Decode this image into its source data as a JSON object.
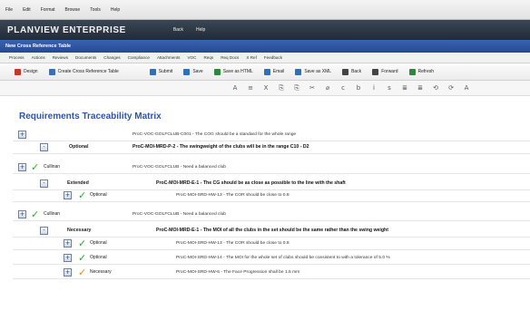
{
  "menubar": {
    "items": [
      "File",
      "Edit",
      "Format",
      "Browse",
      "Tools",
      "Help"
    ]
  },
  "brandbar": {
    "brand": "PLANVIEW ENTERPRISE",
    "nav": [
      "Back",
      "Help"
    ]
  },
  "titlebar": {
    "title": "New Cross Reference Table"
  },
  "tabs": [
    "Process",
    "Actions",
    "Reviews",
    "Documents",
    "Changes",
    "Compliance",
    "Attachments",
    "VOC",
    "Reqs",
    "Req Docs",
    "X Ref",
    "Feedback"
  ],
  "toolbar": {
    "left": [
      {
        "label": "Design",
        "icon": "design-icon",
        "color": "#c0392b"
      },
      {
        "label": "Create Cross Reference Table",
        "icon": "table-icon",
        "color": "#3b6fb6"
      }
    ],
    "right": [
      {
        "label": "Submit",
        "icon": "submit-icon",
        "color": "#2e6fbf"
      },
      {
        "label": "Save",
        "icon": "save-icon",
        "color": "#2e6fbf"
      },
      {
        "label": "Save as HTML",
        "icon": "html-icon",
        "color": "#2a8a3a"
      },
      {
        "label": "Email",
        "icon": "email-icon",
        "color": "#2e6fbf"
      },
      {
        "label": "Save as XML",
        "icon": "xml-icon",
        "color": "#2e6fbf"
      },
      {
        "label": "Back",
        "icon": "back-icon",
        "color": "#444"
      },
      {
        "label": "Forward",
        "icon": "forward-icon",
        "color": "#444"
      },
      {
        "label": "Refresh",
        "icon": "refresh-icon",
        "color": "#2a8a3a"
      }
    ]
  },
  "formatbar": {
    "glyphs": [
      "A",
      "≡",
      "X",
      "⎘",
      "⎘",
      "✂",
      "⌀",
      "c",
      "b",
      "i",
      "s",
      "≣",
      "≣",
      "⟲",
      "⟳",
      "A"
    ]
  },
  "matrix": {
    "title": "Requirements Traceability Matrix",
    "rows": [
      {
        "box": "+",
        "label": "",
        "desc": "ProC-VOC-GOLFCLUB-C001 - The COG should be a standard for the whole range",
        "bold": false
      },
      {
        "box": "-",
        "label": "Optional",
        "desc": "ProC-MOI-MRD-P-2 - The swingweight of the clubs will be in the range C10 - D2",
        "bold": true
      },
      {
        "box": "+",
        "label": "Cullinan",
        "desc": "ProC-VOC-GOLFCLUB - Need a balanced club",
        "bold": false
      },
      {
        "box": "-",
        "label": "Extended",
        "desc": "ProC-MOI-MRD-E-1 - The CG should be as close as possible to the line with the shaft",
        "bold": true
      },
      {
        "box": "+",
        "label": "Optional",
        "desc": "ProC-MOI-SRD-HW-13 - The COR should be close to 0.8",
        "bold": false
      },
      {
        "box": "+",
        "label": "Cullinan",
        "desc": "ProC-VOC-GOLFCLUB - Need a balanced club",
        "bold": false
      },
      {
        "box": "-",
        "label": "Necessary",
        "desc": "ProC-MOI-MRD-E-1 - The MOI of all the clubs in the set should be the same rather than the swing weight",
        "bold": true
      },
      {
        "box": "+",
        "label": "Optional",
        "desc": "ProC-MOI-SRD-HW-13 - The COR should be close to 0.8",
        "bold": false
      },
      {
        "box": "+",
        "label": "Optional",
        "desc": "ProC-MOI-SRD-HW-14 - The MOI for the whole set of clubs should be consistent to with a tolerance of 5.0 %",
        "bold": false
      },
      {
        "box": "+",
        "label": "Necessary",
        "desc": "ProC-MOI-SRD-HW-6 - The Face Progression shall be 1.5 mm",
        "bold": false
      }
    ]
  },
  "colors": {
    "accent": "#2b56a6",
    "check_green": "#31a52f",
    "check_orange": "#f08a12"
  }
}
